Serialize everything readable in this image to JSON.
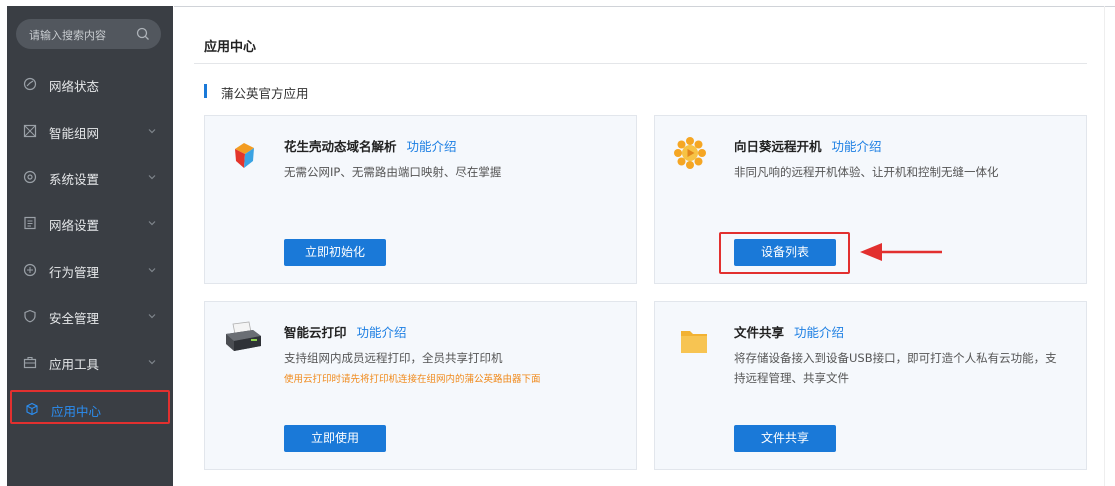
{
  "sidebar": {
    "search_placeholder": "请输入搜索内容",
    "items": [
      {
        "label": "网络状态",
        "icon": "gauge-icon"
      },
      {
        "label": "智能组网",
        "icon": "network-icon"
      },
      {
        "label": "系统设置",
        "icon": "gear-icon"
      },
      {
        "label": "网络设置",
        "icon": "document-icon"
      },
      {
        "label": "行为管理",
        "icon": "behavior-icon"
      },
      {
        "label": "安全管理",
        "icon": "shield-icon"
      },
      {
        "label": "应用工具",
        "icon": "toolbox-icon"
      },
      {
        "label": "应用中心",
        "icon": "cube-icon"
      }
    ]
  },
  "main": {
    "title": "应用中心",
    "section_title": "蒲公英官方应用",
    "cards": [
      {
        "name": "花生壳动态域名解析",
        "link": "功能介绍",
        "desc": "无需公网IP、无需路由端口映射、尽在掌握",
        "button": "立即初始化",
        "icon": "peanut-shell-icon"
      },
      {
        "name": "向日葵远程开机",
        "link": "功能介绍",
        "desc": "非同凡响的远程开机体验、让开机和控制无缝一体化",
        "button": "设备列表",
        "icon": "sunflower-icon"
      },
      {
        "name": "智能云打印",
        "link": "功能介绍",
        "desc": "支持组网内成员远程打印，全员共享打印机",
        "note": "使用云打印时请先将打印机连接在组网内的蒲公英路由器下面",
        "button": "立即使用",
        "icon": "printer-icon"
      },
      {
        "name": "文件共享",
        "link": "功能介绍",
        "desc_line1": "将存储设备接入到设备USB接口，即可打造个人私有云功能，支",
        "desc_line2": "持远程管理、共享文件",
        "button": "文件共享",
        "icon": "folder-icon"
      }
    ]
  },
  "colors": {
    "sidebar_bg": "#3a3e44",
    "accent": "#1a79d8",
    "highlight": "#e2302f",
    "active_text": "#2b8ef2",
    "note": "#f08a1c"
  }
}
